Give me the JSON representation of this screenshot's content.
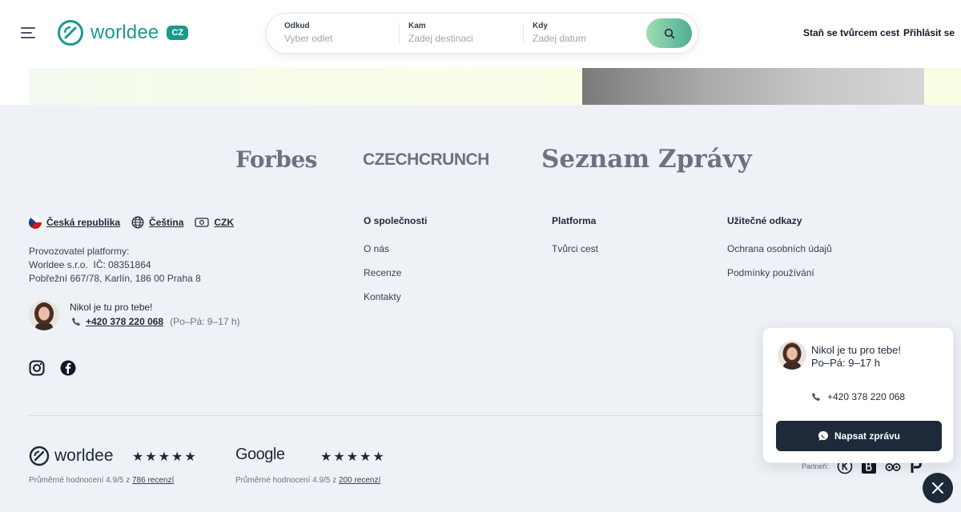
{
  "header": {
    "logo_text": "worldee",
    "logo_badge": "CZ",
    "search": {
      "from_label": "Odkud",
      "from_placeholder": "Vyber odlet",
      "to_label": "Kam",
      "to_placeholder": "Zadej destinaci",
      "when_label": "Kdy",
      "when_placeholder": "Zadej datum",
      "button_icon": "search-icon"
    },
    "become_creator": "Staň se tvůrcem cest",
    "login": "Přihlásit se"
  },
  "press": {
    "items": [
      "Forbes",
      "CZECHCRUNCH",
      "Seznam Zprávy"
    ]
  },
  "footer": {
    "locale": {
      "country": "Česká republika",
      "language": "Čeština",
      "currency": "CZK"
    },
    "company": {
      "line1": "Provozovatel platformy:",
      "line2": "Worldee s.r.o.  IČ: 08351864",
      "line3": "Pobřežní 667/78, Karlín, 186 00 Praha 8"
    },
    "contact": {
      "greeting": "Nikol je tu pro tebe!",
      "phone": "+420 378 220 068",
      "hours": "(Po–Pá: 9–17 h)"
    },
    "columns": [
      {
        "title": "O společnosti",
        "links": [
          "O nás",
          "Recenze",
          "Kontakty"
        ]
      },
      {
        "title": "Platforma",
        "links": [
          "Tvůrci cest"
        ]
      },
      {
        "title": "Užitečné odkazy",
        "links": [
          "Ochrana osobních údajů",
          "Podmínky používání"
        ]
      }
    ],
    "ratings": {
      "worldee_logo": "worldee",
      "worldee_stars": "★★★★★",
      "worldee_text": "Průměrné hodnocení 4.9/5 z ",
      "worldee_link": "786 recenzí",
      "google_logo": "Google",
      "google_stars": "★★★★★",
      "google_text": "Průměrné hodnocení 4.9/5 z ",
      "google_link": "200 recenzí"
    },
    "partners_label": "Partneři:"
  },
  "chat": {
    "greeting_line1": "Nikol je tu pro tebe!",
    "greeting_line2": "Po–Pá: 9–17 h",
    "phone": "+420 378 220 068",
    "button": "Napsat zprávu"
  },
  "colors": {
    "brand": "#1a9a8a",
    "dark": "#1e2a3a",
    "footer_bg": "#eef2f7"
  }
}
